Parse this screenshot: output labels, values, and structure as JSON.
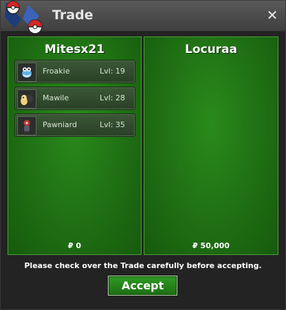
{
  "window": {
    "title": "Trade",
    "close_symbol": "✕"
  },
  "left_panel": {
    "name": "Mitesx21",
    "pokemon": [
      {
        "name": "Froakie",
        "level": "Lvl: 19",
        "icon": "froakie-sprite"
      },
      {
        "name": "Mawile",
        "level": "Lvl: 28",
        "icon": "mawile-sprite"
      },
      {
        "name": "Pawniard",
        "level": "Lvl: 35",
        "icon": "pawniard-sprite"
      }
    ],
    "money": "₽ 0"
  },
  "right_panel": {
    "name": "Locuraa",
    "pokemon": [],
    "money": "₽ 50,000"
  },
  "notice": "Please check over the Trade carefully before accepting.",
  "accept_label": "Accept",
  "colors": {
    "panel_green": "#1f6f13",
    "panel_border": "#4f9d3a",
    "titlebar": "#4a4a4a",
    "button_green": "#2f9a23"
  }
}
